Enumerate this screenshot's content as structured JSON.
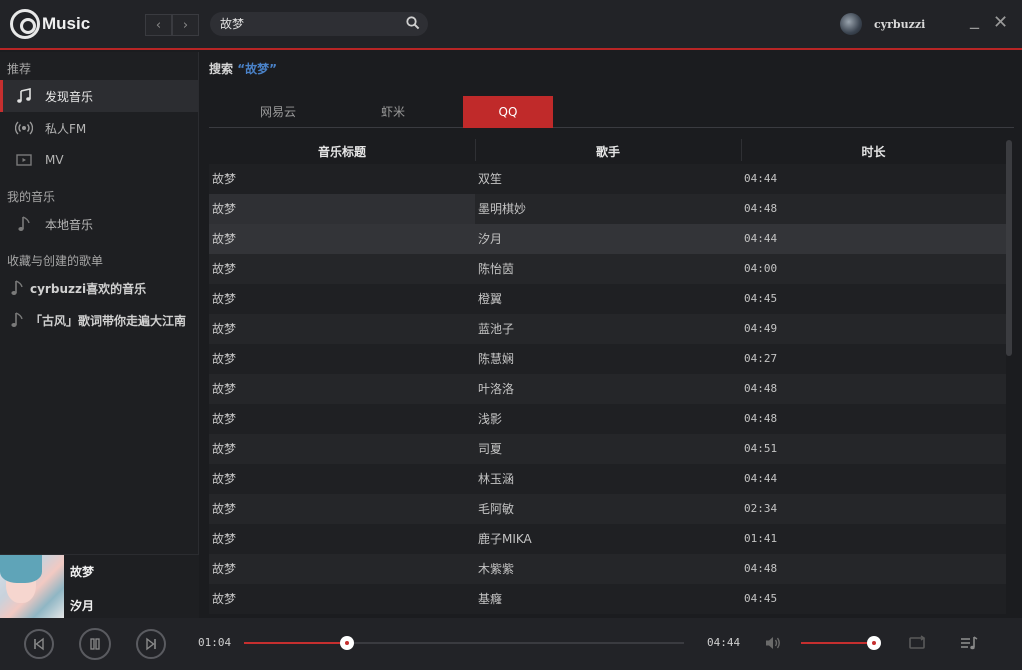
{
  "app": {
    "logo_text": "Music"
  },
  "titlebar": {
    "back_glyph": "‹",
    "forward_glyph": "›",
    "search_value": "故梦",
    "username": "cyrbuzzi",
    "minimize_glyph": "_",
    "close_glyph": "✕"
  },
  "sidebar": {
    "section_recommend": "推荐",
    "items": [
      {
        "label": "发现音乐",
        "icon": "music-note-icon",
        "active": true
      },
      {
        "label": "私人FM",
        "icon": "radio-icon",
        "active": false
      },
      {
        "label": "MV",
        "icon": "video-icon",
        "active": false
      }
    ],
    "section_my_music": "我的音乐",
    "my_items": [
      {
        "label": "本地音乐",
        "icon": "music-note-icon"
      }
    ],
    "section_playlists": "收藏与创建的歌单",
    "playlists": [
      {
        "label": "cyrbuzzi喜欢的音乐"
      },
      {
        "label": "「古风」歌词带你走遍大江南"
      }
    ],
    "now_playing": {
      "title": "故梦",
      "artist": "汐月"
    }
  },
  "main": {
    "search_prefix": "搜索",
    "search_keyword": "“故梦”",
    "tabs": [
      {
        "label": "网易云",
        "active": false
      },
      {
        "label": "虾米",
        "active": false
      },
      {
        "label": "QQ",
        "active": true
      }
    ],
    "columns": [
      "音乐标题",
      "歌手",
      "时长"
    ],
    "rows": [
      {
        "title": "故梦",
        "artist": "双笙",
        "duration": "04:44"
      },
      {
        "title": "故梦",
        "artist": "墨明棋妙",
        "duration": "04:48"
      },
      {
        "title": "故梦",
        "artist": "汐月",
        "duration": "04:44"
      },
      {
        "title": "故梦",
        "artist": "陈怡茵",
        "duration": "04:00"
      },
      {
        "title": "故梦",
        "artist": "橙翼",
        "duration": "04:45"
      },
      {
        "title": "故梦",
        "artist": "蓝池子",
        "duration": "04:49"
      },
      {
        "title": "故梦",
        "artist": "陈慧娴",
        "duration": "04:27"
      },
      {
        "title": "故梦",
        "artist": "叶洛洛",
        "duration": "04:48"
      },
      {
        "title": "故梦",
        "artist": "浅影",
        "duration": "04:48"
      },
      {
        "title": "故梦",
        "artist": "司夏",
        "duration": "04:51"
      },
      {
        "title": "故梦",
        "artist": "林玉涵",
        "duration": "04:44"
      },
      {
        "title": "故梦",
        "artist": "毛阿敏",
        "duration": "02:34"
      },
      {
        "title": "故梦",
        "artist": "鹿子MIKA",
        "duration": "01:41"
      },
      {
        "title": "故梦",
        "artist": "木紫紫",
        "duration": "04:48"
      },
      {
        "title": "故梦",
        "artist": "基癃",
        "duration": "04:45"
      }
    ]
  },
  "player": {
    "current_time": "01:04",
    "total_time": "04:44",
    "progress": 0.235,
    "volume": 1.0
  },
  "colors": {
    "accent": "#c62f2f",
    "link": "#4a82c8",
    "background": "#1b1c1f"
  }
}
